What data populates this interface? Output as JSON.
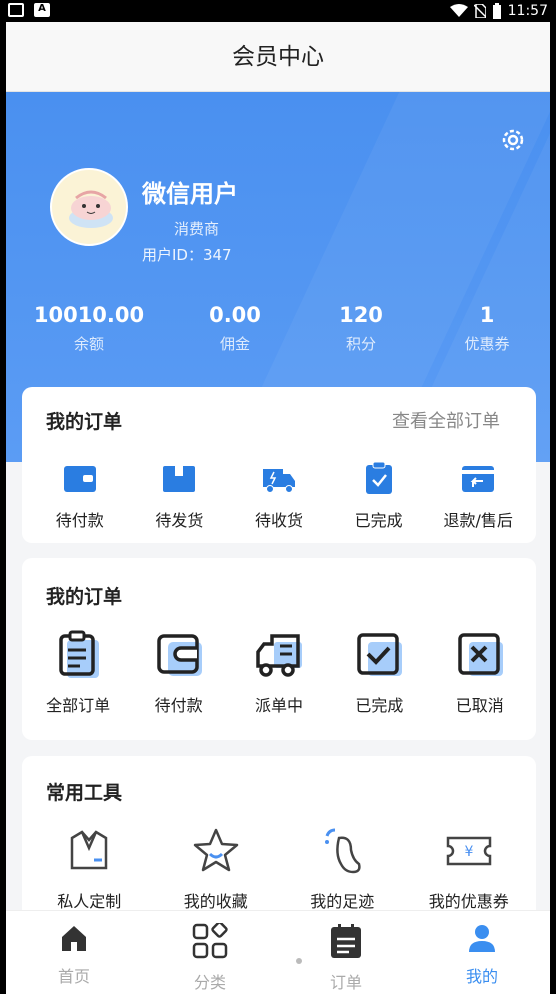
{
  "status_bar": {
    "time": "11:57"
  },
  "header": {
    "title": "会员中心"
  },
  "profile": {
    "name": "微信用户",
    "role": "消费商",
    "user_id": "用户ID：347"
  },
  "stats": [
    {
      "value": "10010.00",
      "label": "余额"
    },
    {
      "value": "0.00",
      "label": "佣金"
    },
    {
      "value": "120",
      "label": "积分"
    },
    {
      "value": "1",
      "label": "优惠券"
    }
  ],
  "orders": {
    "title": "我的订单",
    "view_all": "查看全部订单",
    "items": [
      {
        "label": "待付款",
        "icon": "wallet-icon"
      },
      {
        "label": "待发货",
        "icon": "package-icon"
      },
      {
        "label": "待收货",
        "icon": "truck-icon"
      },
      {
        "label": "已完成",
        "icon": "clipboard-check-icon"
      },
      {
        "label": "退款/售后",
        "icon": "refund-icon"
      }
    ]
  },
  "orders2": {
    "title": "我的订单",
    "items": [
      {
        "label": "全部订单",
        "icon": "clipboard-list-icon"
      },
      {
        "label": "待付款",
        "icon": "wallet-icon"
      },
      {
        "label": "派单中",
        "icon": "truck-icon"
      },
      {
        "label": "已完成",
        "icon": "check-square-icon"
      },
      {
        "label": "已取消",
        "icon": "x-square-icon"
      }
    ]
  },
  "tools": {
    "title": "常用工具",
    "items": [
      {
        "label": "私人定制",
        "icon": "suit-icon"
      },
      {
        "label": "我的收藏",
        "icon": "star-icon"
      },
      {
        "label": "我的足迹",
        "icon": "footprint-icon"
      },
      {
        "label": "我的优惠券",
        "icon": "coupon-icon"
      }
    ]
  },
  "nav": [
    {
      "label": "首页",
      "icon": "home-icon"
    },
    {
      "label": "分类",
      "icon": "category-icon"
    },
    {
      "label": "订单",
      "icon": "order-icon"
    },
    {
      "label": "我的",
      "icon": "user-icon"
    }
  ],
  "colors": {
    "primary": "#4a90f0",
    "active": "#3a8ef0"
  }
}
